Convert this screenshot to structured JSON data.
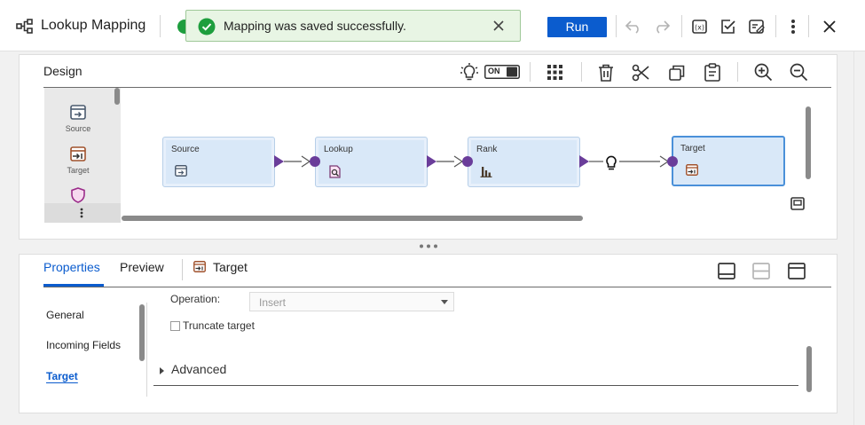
{
  "header": {
    "title": "Lookup Mapping",
    "run_label": "Run"
  },
  "toast": {
    "message": "Mapping was saved successfully.",
    "status_color": "#1e9e3e"
  },
  "design": {
    "title": "Design",
    "toggle_label": "ON",
    "palette": [
      {
        "label": "Source",
        "icon": "source-icon"
      },
      {
        "label": "Target",
        "icon": "target-icon"
      },
      {
        "label": "",
        "icon": "shield-icon"
      }
    ],
    "nodes": [
      {
        "label": "Source",
        "icon": "source-icon"
      },
      {
        "label": "Lookup",
        "icon": "lookup-icon"
      },
      {
        "label": "Rank",
        "icon": "rank-icon"
      },
      {
        "label": "Target",
        "icon": "target-icon"
      }
    ]
  },
  "properties": {
    "tabs": [
      "Properties",
      "Preview"
    ],
    "context_label": "Target",
    "nav": [
      "General",
      "Incoming Fields",
      "Target"
    ],
    "operation_label": "Operation:",
    "operation_value": "Insert",
    "truncate_label": "Truncate target",
    "advanced_label": "Advanced"
  },
  "colors": {
    "accent": "#0b5cce",
    "port": "#6a3d9a",
    "node_fill": "#d9e8f8"
  }
}
